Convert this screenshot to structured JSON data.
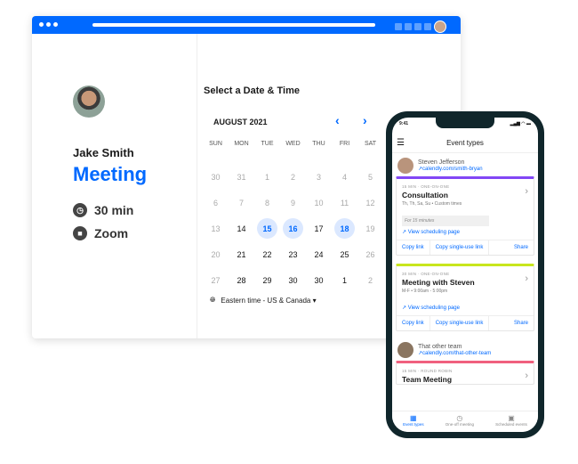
{
  "browser": {
    "accent": "#0069ff"
  },
  "profile": {
    "name": "Jake Smith",
    "event": "Meeting",
    "duration": "30 min",
    "location": "Zoom"
  },
  "calendar": {
    "title": "Select a Date & Time",
    "month": "AUGUST 2021",
    "prev": "‹",
    "next": "›",
    "weekdays": [
      "SUN",
      "MON",
      "TUE",
      "WED",
      "THU",
      "FRI",
      "SAT"
    ],
    "days": [
      {
        "n": "30",
        "s": "d"
      },
      {
        "n": "31",
        "s": "d"
      },
      {
        "n": "1",
        "s": "d"
      },
      {
        "n": "2",
        "s": "d"
      },
      {
        "n": "3",
        "s": "d"
      },
      {
        "n": "4",
        "s": "d"
      },
      {
        "n": "5",
        "s": "d"
      },
      {
        "n": "6",
        "s": "d"
      },
      {
        "n": "7",
        "s": "d"
      },
      {
        "n": "8",
        "s": "d"
      },
      {
        "n": "9",
        "s": "d"
      },
      {
        "n": "10",
        "s": "d"
      },
      {
        "n": "11",
        "s": "d"
      },
      {
        "n": "12",
        "s": "d"
      },
      {
        "n": "13",
        "s": "d"
      },
      {
        "n": "14",
        "s": "a"
      },
      {
        "n": "15",
        "s": "h"
      },
      {
        "n": "16",
        "s": "h"
      },
      {
        "n": "17",
        "s": "a"
      },
      {
        "n": "18",
        "s": "h"
      },
      {
        "n": "19",
        "s": "d"
      },
      {
        "n": "20",
        "s": "d"
      },
      {
        "n": "21",
        "s": "a"
      },
      {
        "n": "22",
        "s": "a"
      },
      {
        "n": "23",
        "s": "a"
      },
      {
        "n": "24",
        "s": "a"
      },
      {
        "n": "25",
        "s": "a"
      },
      {
        "n": "26",
        "s": "d"
      },
      {
        "n": "27",
        "s": "d"
      },
      {
        "n": "28",
        "s": "a"
      },
      {
        "n": "29",
        "s": "a"
      },
      {
        "n": "30",
        "s": "a"
      },
      {
        "n": "30",
        "s": "a"
      },
      {
        "n": "1",
        "s": "a"
      },
      {
        "n": "2",
        "s": "d"
      }
    ],
    "timezone": "Eastern time - US & Canada ▾"
  },
  "phone": {
    "time": "9:41",
    "header": "Event types",
    "user1": {
      "name": "Steven Jefferson",
      "link": "↗calendly.com/smith-bryan"
    },
    "card1": {
      "kicker": "15 MIN · ONE-ON-ONE",
      "title": "Consultation",
      "sub": "Th, Th, Sa, Su • Custom times",
      "pill": "For 15 minutes",
      "view": "↗ View scheduling page",
      "color": "#8247f5"
    },
    "card2": {
      "kicker": "30 MIN · ONE-ON-ONE",
      "title": "Meeting with Steven",
      "sub": "M-F • 9:00am - 5:00pm",
      "view": "↗ View scheduling page",
      "color": "#c8e61e"
    },
    "actions": [
      "Copy link",
      "Copy single-use link",
      "Share"
    ],
    "user2": {
      "name": "That other team",
      "link": "↗calendly.com/that-other-team"
    },
    "card3": {
      "kicker": "15 MIN · ROUND ROBIN",
      "title": "Team Meeting",
      "color": "#f0607e"
    },
    "tabs": [
      "Event types",
      "One-off meeting",
      "Scheduled events"
    ]
  }
}
